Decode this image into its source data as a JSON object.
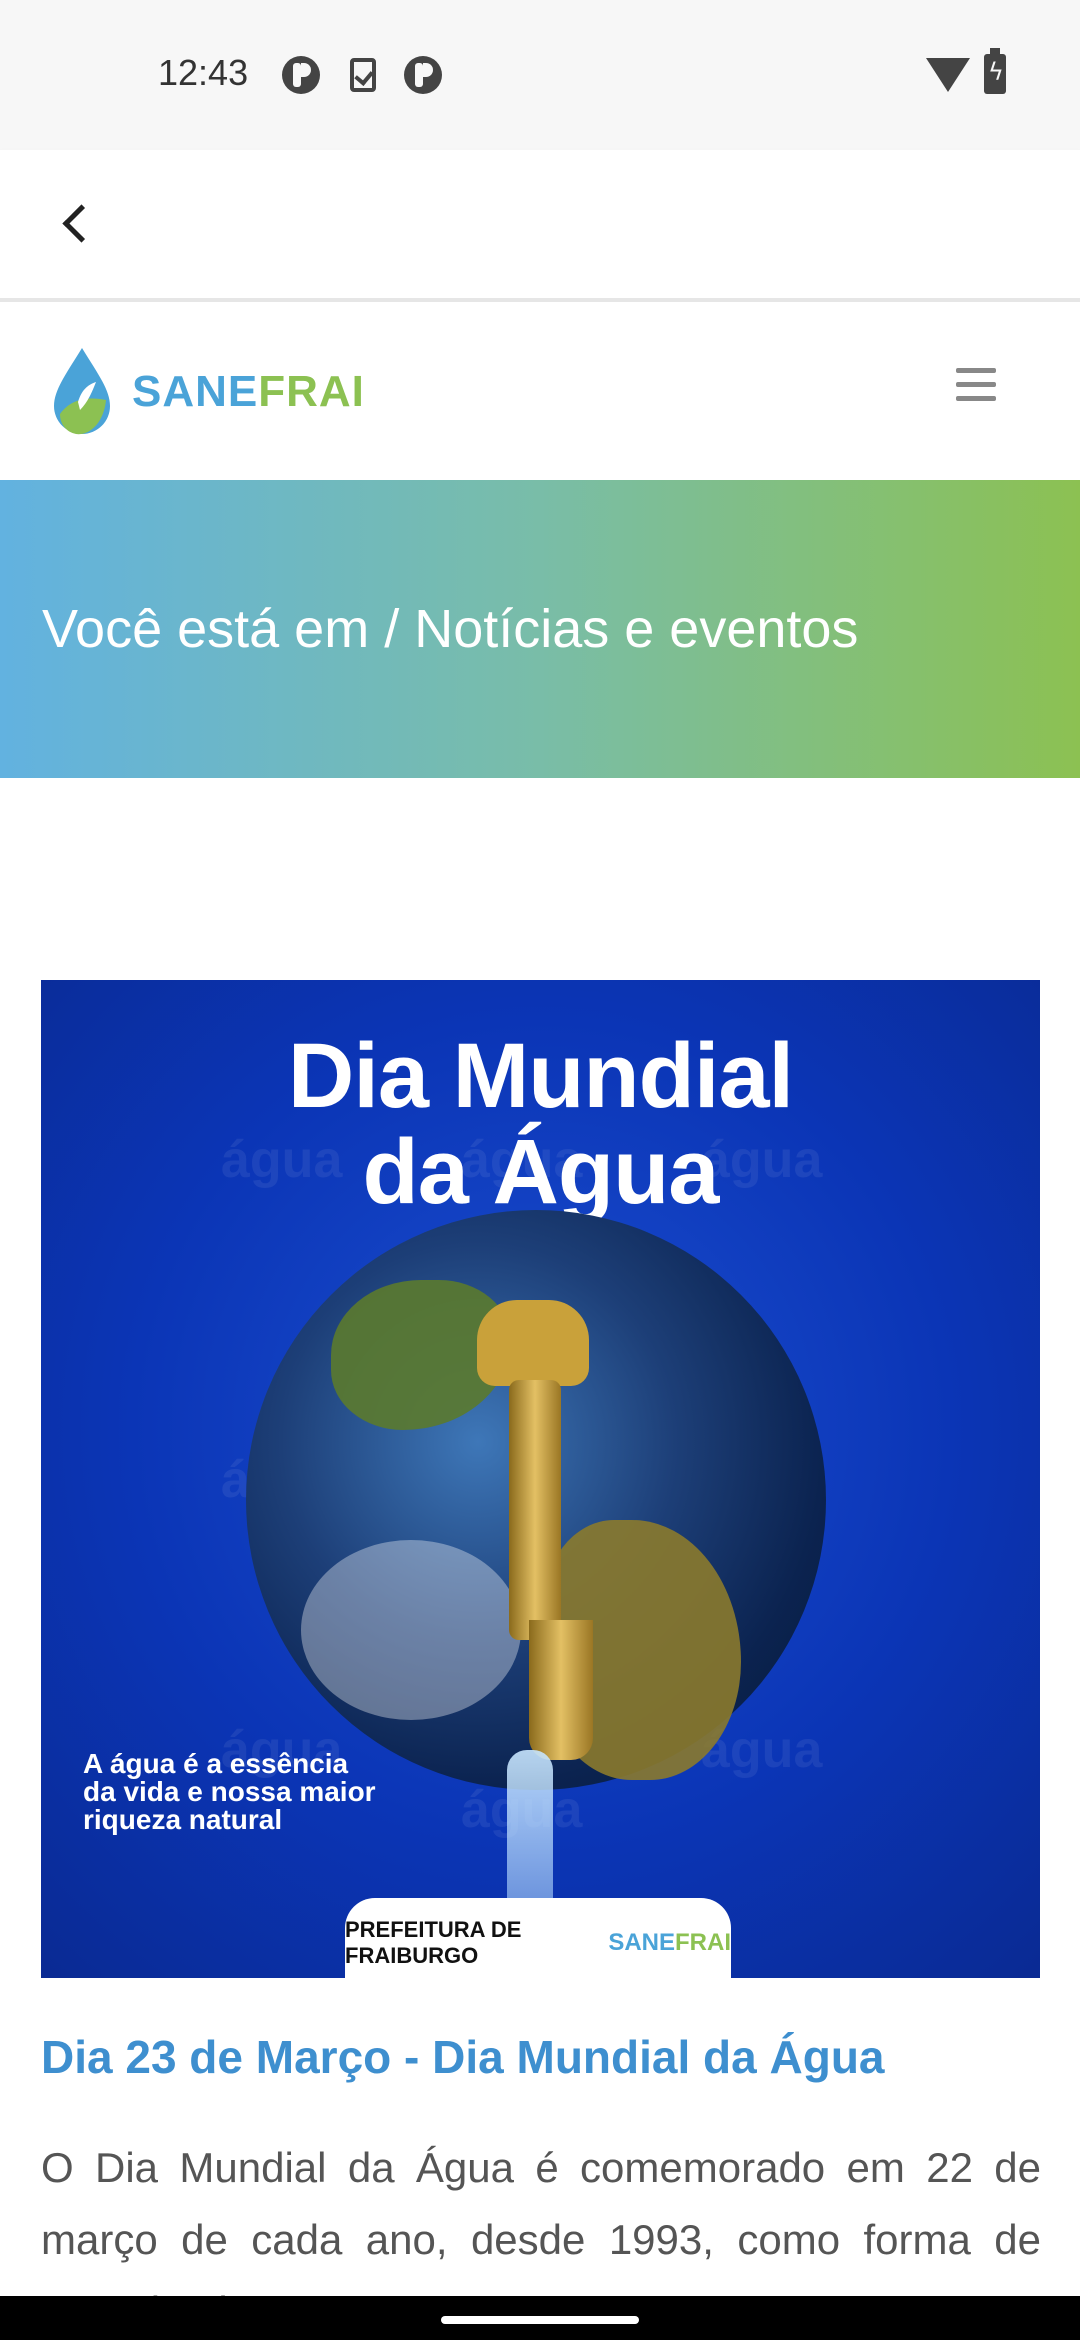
{
  "status_bar": {
    "time": "12:43",
    "icons": [
      "app-icon",
      "clipboard-check-icon",
      "app-icon",
      "wifi-icon",
      "battery-charging-icon"
    ]
  },
  "app_bar": {
    "back_icon": "chevron-left-icon"
  },
  "site_header": {
    "logo_part1": "SANE",
    "logo_part2": "FRAI",
    "menu_icon": "hamburger-icon",
    "colors": {
      "blue": "#4aa3d8",
      "green": "#8cc152"
    }
  },
  "banner": {
    "breadcrumb": "Você está em / Notícias e eventos",
    "gradient": [
      "#62b2e0",
      "#8cc152"
    ]
  },
  "article": {
    "image": {
      "title_line1": "Dia Mundial",
      "title_line2": "da Água",
      "background_word": "água",
      "tagline_line1": "A água é a essência",
      "tagline_line2": "da vida e nossa maior",
      "tagline_line3": "riqueza natural",
      "footer_left": "PREFEITURA DE FRAIBURGO",
      "footer_right_part1": "SANE",
      "footer_right_part2": "FRAI"
    },
    "title": "Dia 23 de Março - Dia Mundial da Água",
    "body": "O Dia Mundial da Água é comemorado em 22 de março de cada ano, desde 1993, como forma de conscientização"
  }
}
